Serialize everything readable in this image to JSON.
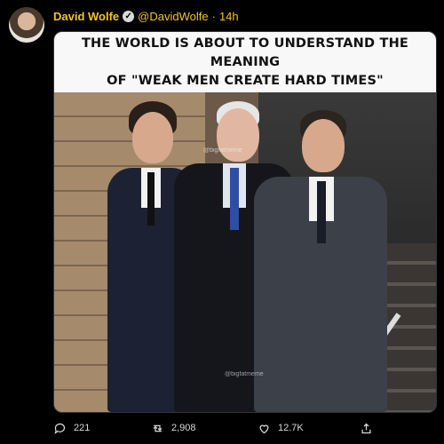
{
  "tweet": {
    "display_name": "David Wolfe",
    "verified_mark": "✓",
    "handle": "@DavidWolfe",
    "separator": "·",
    "time": "14h"
  },
  "media": {
    "caption_line1": "The world is about to understand the meaning",
    "caption_line2": "of \"weak men create hard times\"",
    "watermark_top": "@bigfatmeme",
    "watermark_bottom": "@bigfatmeme"
  },
  "actions": {
    "reply_count": "221",
    "retweet_count": "2,908",
    "like_count": "12.7K"
  },
  "icons": {
    "reply": "speech-bubble-icon",
    "retweet": "retweet-arrows-icon",
    "like": "heart-icon",
    "share": "share-upload-icon"
  },
  "colors": {
    "background": "#000000",
    "name_accent": "#f5c518",
    "action_text": "#d9d9d9"
  }
}
